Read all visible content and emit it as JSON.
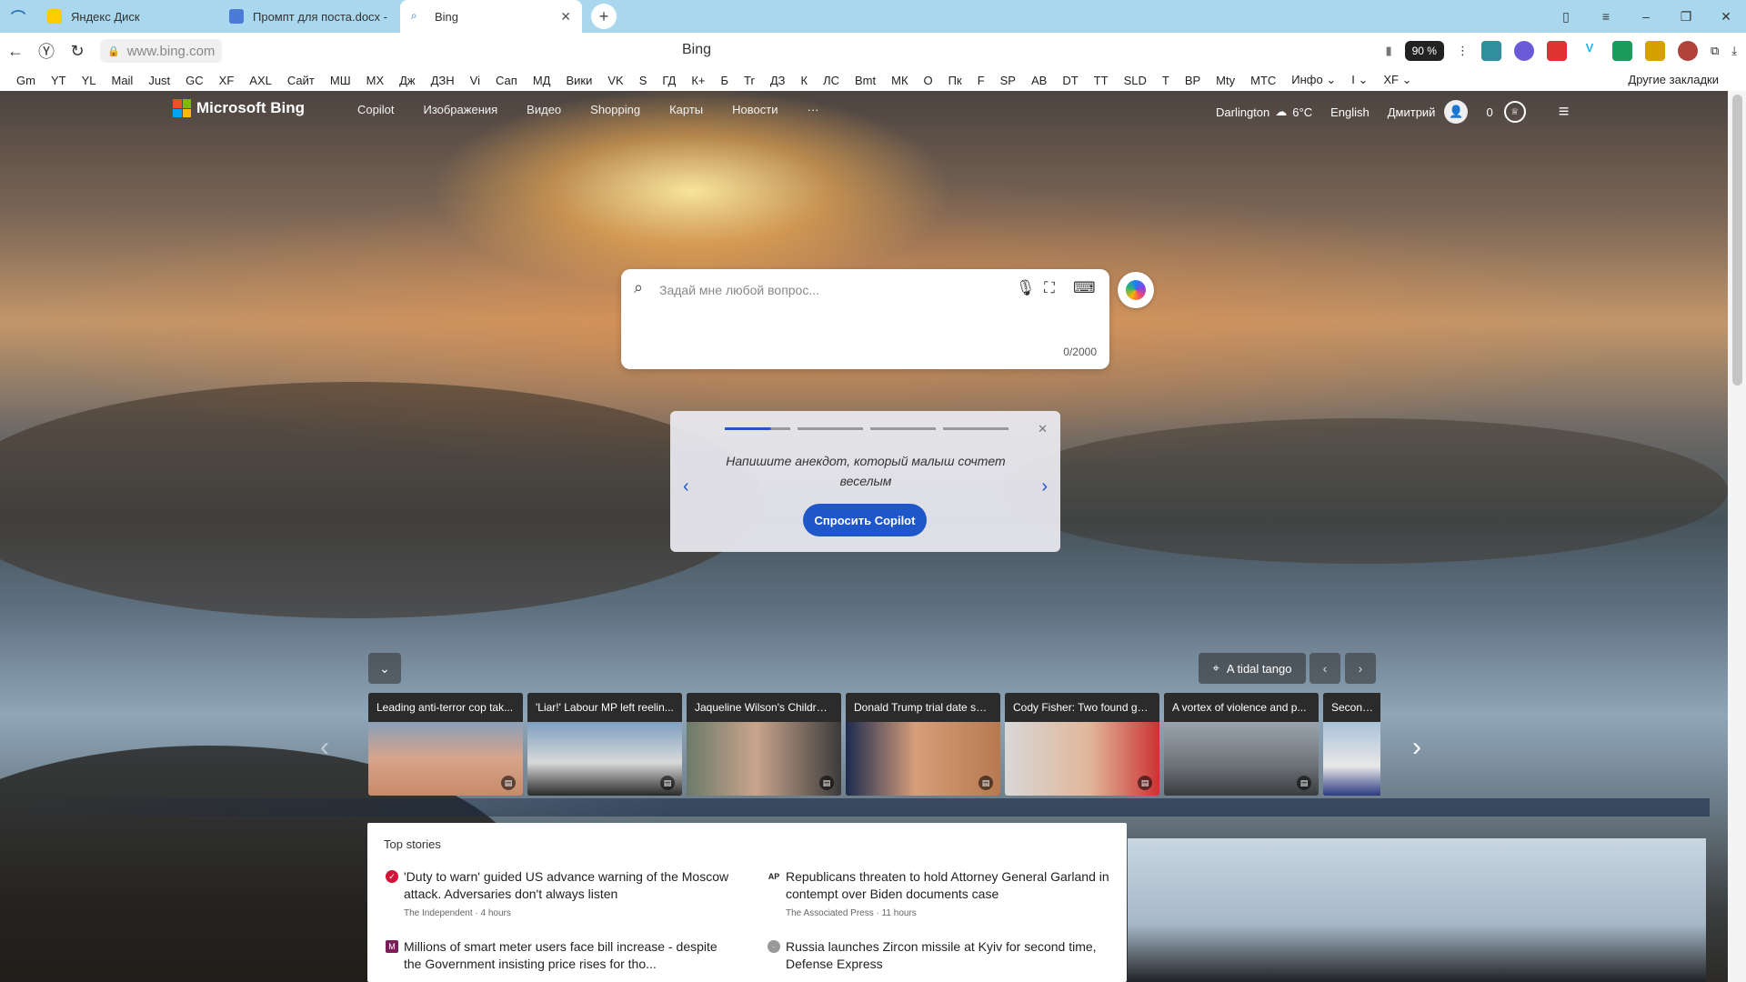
{
  "browser": {
    "tabs": [
      {
        "label": "Яндекс Диск",
        "color": "#ffcc00"
      },
      {
        "label": "Промпт для поста.docx -",
        "color": "#4a7bd8"
      },
      {
        "label": "Bing",
        "color": "#2a6fb7"
      }
    ],
    "url": "www.bing.com",
    "page_title": "Bing",
    "zoom": "90 %",
    "bookmarks": [
      "Gm",
      "YT",
      "YL",
      "Mail",
      "Just",
      "GC",
      "XF",
      "AXL",
      "Сайт",
      "МШ",
      "МХ",
      "Дж",
      "ДЗН",
      "Vi",
      "Сап",
      "МД",
      "Вики",
      "VK",
      "S",
      "ГД",
      "К+",
      "Б",
      "Tr",
      "ДЗ",
      "К",
      "ЛС",
      "Bmt",
      "МК",
      "О",
      "Пк",
      "F",
      "SP",
      "АВ",
      "DT",
      "ТТ",
      "SLD",
      "Т",
      "ВР",
      "Mty",
      "МТС",
      "Инфо ⌄",
      "І ⌄",
      "XF ⌄"
    ],
    "other_bookmarks": "Другие закладки"
  },
  "bing": {
    "logo": "Microsoft Bing",
    "nav": [
      "Copilot",
      "Изображения",
      "Видео",
      "Shopping",
      "Карты",
      "Новости",
      "···"
    ],
    "location": "Darlington",
    "temp": "6°C",
    "language": "English",
    "user": "Дмитрий",
    "points": "0",
    "search": {
      "placeholder": "Задай мне любой вопрос...",
      "counter": "0/2000"
    },
    "prompt": {
      "text": "Напишите анекдот, который малыш сочтет веселым",
      "button": "Спросить Copilot"
    },
    "image_location": "A tidal tango",
    "news_cards": [
      {
        "title": "Leading anti-terror cop tak...",
        "bg": "linear-gradient(180deg,#8aa0b8,#d7a48a 50%,#c98a6a)"
      },
      {
        "title": "'Liar!' Labour MP left reelin...",
        "bg": "linear-gradient(180deg,#7f9fc0,#d9d9d9 55%,#2a2a2a)"
      },
      {
        "title": "Jaqueline Wilson's Children...",
        "bg": "linear-gradient(90deg,#6b7a6a,#c9a58c 45%,#3b3b3b)"
      },
      {
        "title": "Donald Trump trial date set...",
        "bg": "linear-gradient(90deg,#1d2b4f,#d69e7a 45%,#b8794f)"
      },
      {
        "title": "Cody Fisher: Two found gui...",
        "bg": "linear-gradient(90deg,#d8d8d8,#e1b69a 55%,#c33)"
      },
      {
        "title": "A vortex of violence and p...",
        "bg": "linear-gradient(180deg,#9aa4ad,#6c7176 60%,#3a3d40)"
      },
      {
        "title": "Secondary",
        "bg": "linear-gradient(180deg,#a9c1d8,#e8e8e8 60%,#2a3a80)"
      }
    ],
    "top_stories": {
      "heading": "Top stories",
      "items": [
        {
          "title": "'Duty to warn' guided US advance warning of the Moscow attack. Adversaries don't always listen",
          "meta": "The Independent · 4 hours",
          "icon": "independent-icon",
          "color": "#d2143a",
          "glyph": "✓"
        },
        {
          "title": "Republicans threaten to hold Attorney General Garland in contempt over Biden documents case",
          "meta": "The Associated Press · 11 hours",
          "icon": "ap-icon",
          "color": "#ffffff",
          "glyph": "AP"
        },
        {
          "title": "Millions of smart meter users face bill increase - despite the Government insisting price rises for tho...",
          "meta": "",
          "icon": "metro-icon",
          "color": "#7a1f5c",
          "glyph": "M"
        },
        {
          "title": "Russia launches Zircon missile at Kyiv for second time, Defense Express",
          "meta": "",
          "icon": "source-icon",
          "color": "#999999",
          "glyph": "·"
        }
      ]
    }
  }
}
